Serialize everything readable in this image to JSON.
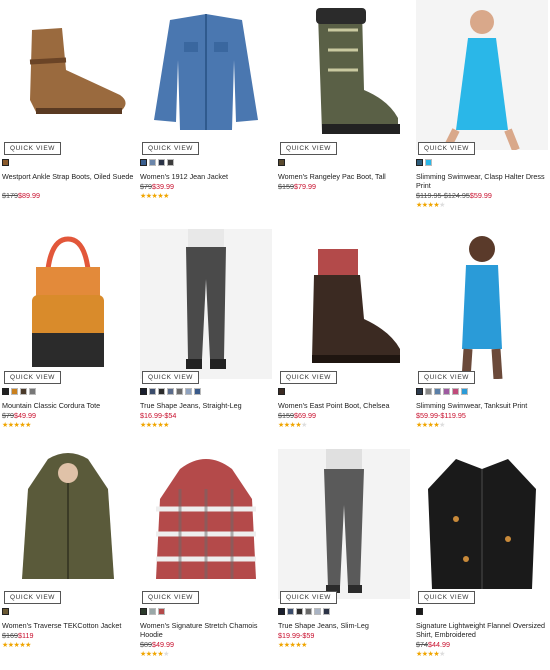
{
  "quick_view_label": "QUICK VIEW",
  "products": [
    {
      "name": "Westport Ankle Strap Boots, Oiled Suede",
      "was": "$179",
      "now": "$89.99",
      "rating": 0,
      "swatches": [
        "#8b5a2b"
      ],
      "icon": "ankle-boot-image"
    },
    {
      "name": "Women's 1912 Jean Jacket",
      "was": "$79",
      "now": "$39.99",
      "rating": 4.5,
      "swatches": [
        "#3a5f8f",
        "#6b86aa",
        "#2b3346",
        "#3c3c3c"
      ],
      "icon": "jean-jacket-image"
    },
    {
      "name": "Women's Rangeley Pac Boot, Tall",
      "was": "$159",
      "now": "$79.99",
      "rating": 0,
      "swatches": [
        "#5a4a2e"
      ],
      "icon": "pac-boot-image"
    },
    {
      "name": "Slimming Swimwear, Clasp Halter Dress Print",
      "was": "$119.95-$124.95",
      "now": "$59.99",
      "rating": 4,
      "swatches": [
        "#2d5c7a",
        "#2ab7e8"
      ],
      "icon": "halter-dress-image"
    },
    {
      "name": "Mountain Classic Cordura Tote",
      "was": "$79",
      "now": "$49.99",
      "rating": 4.5,
      "swatches": [
        "#222222",
        "#c9801e",
        "#4a3a2a",
        "#777777"
      ],
      "icon": "tote-bag-image"
    },
    {
      "name": "True Shape Jeans, Straight-Leg",
      "range": "$16.99-$54",
      "rating": 4.5,
      "swatches": [
        "#1a1f2e",
        "#3b4c6b",
        "#2b2b2b",
        "#5a6b8a",
        "#6a6a6a",
        "#8fa2bf",
        "#3a5a8a"
      ],
      "icon": "straight-jeans-image"
    },
    {
      "name": "Women's East Point Boot, Chelsea",
      "was": "$159",
      "now": "$69.99",
      "rating": 4,
      "swatches": [
        "#3b2a22"
      ],
      "icon": "chelsea-boot-image"
    },
    {
      "name": "Slimming Swimwear, Tanksuit Print",
      "range": "$59.99-$119.95",
      "rating": 4,
      "swatches": [
        "#2b3a4c",
        "#888888",
        "#5a7fa8",
        "#9e5aa0",
        "#c04a7a",
        "#2a9bd8"
      ],
      "icon": "tanksuit-image"
    },
    {
      "name": "Women's Traverse TEKCotton Jacket",
      "was": "$169",
      "now": "$119",
      "rating": 4.5,
      "swatches": [
        "#6b5a33"
      ],
      "icon": "traverse-jacket-image"
    },
    {
      "name": "Women's Signature Stretch Chamois Hoodie",
      "was": "$89",
      "now": "$49.99",
      "rating": 3.5,
      "swatches": [
        "#2b3a2b",
        "#9aa8a8",
        "#b44a4a"
      ],
      "icon": "chamois-hoodie-image"
    },
    {
      "name": "True Shape Jeans, Slim-Leg",
      "range": "$19.99-$59",
      "rating": 4.5,
      "swatches": [
        "#1a1f2e",
        "#3b4c6b",
        "#2b2b2b",
        "#6a6a6a",
        "#aab4c4",
        "#2b3346"
      ],
      "icon": "slim-jeans-image"
    },
    {
      "name": "Signature Lightweight Flannel Oversized Shirt, Embroidered",
      "was": "$74",
      "now": "$44.99",
      "rating": 3.5,
      "swatches": [
        "#1a1a1a"
      ],
      "icon": "flannel-shirt-image"
    }
  ]
}
